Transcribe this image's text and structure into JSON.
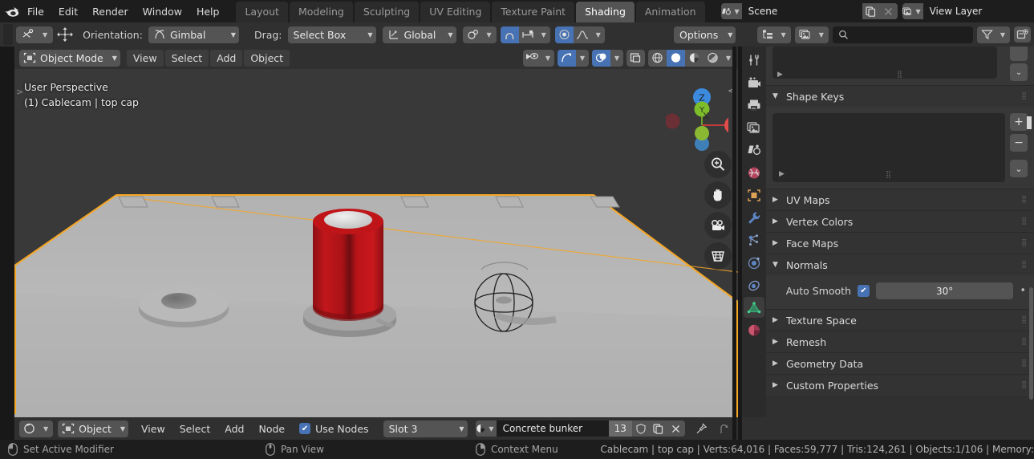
{
  "app": {
    "name": "Blender",
    "logo_icon": "blender-logo"
  },
  "topbar": {
    "menus": [
      "File",
      "Edit",
      "Render",
      "Window",
      "Help"
    ],
    "workspaces": [
      {
        "label": "Layout",
        "active": false
      },
      {
        "label": "Modeling",
        "active": false
      },
      {
        "label": "Sculpting",
        "active": false
      },
      {
        "label": "UV Editing",
        "active": false
      },
      {
        "label": "Texture Paint",
        "active": false
      },
      {
        "label": "Shading",
        "active": true
      },
      {
        "label": "Animation",
        "active": false
      }
    ],
    "scene": {
      "icon": "scene-icon",
      "value": "Scene",
      "new_icon": "duplicate-icon",
      "unlink_icon": "close-icon"
    },
    "view_layer": {
      "icon": "view-layer-icon",
      "value": "View Layer",
      "new_icon": "duplicate-icon",
      "unlink_icon": "close-icon"
    }
  },
  "tool_header": {
    "active_tool_icon": "tweak-tool-icon",
    "transform_icon": "move-gizmo-icon",
    "orientation_label": "Orientation:",
    "orientation_value": "Gimbal",
    "orientation_icon": "gimbal-icon",
    "drag_label": "Drag:",
    "drag_value": "Select Box",
    "transform_space_icon": "global-axes-icon",
    "transform_space_value": "Global",
    "snap_icon": "snap-magnet-icon",
    "snap_target_icon": "snap-increment-icon",
    "proportional_icon": "proportional-edit-icon",
    "falloff_icon": "smooth-falloff-icon",
    "options_label": "Options"
  },
  "outliner_header": {
    "display_mode_icon": "outliner-display-icon",
    "id_type_icon": "image-data-icon",
    "search_icon": "search-icon",
    "search_value": "",
    "search_placeholder": "",
    "filter_icon": "filter-funnel-icon",
    "new_collection_icon": "new-collection-icon"
  },
  "viewport_header": {
    "mode": "Object Mode",
    "mode_icon": "object-mode-icon",
    "menus": [
      "View",
      "Select",
      "Add",
      "Object"
    ],
    "visibility_icon": "show-hide-eye-icon",
    "gizmo_icon": "gizmo-arrow-icon",
    "gizmo_active": true,
    "overlays_icon": "overlays-icon",
    "overlays_active": true,
    "xray_icon": "xray-toggle-icon",
    "shading_modes": [
      {
        "icon": "wireframe-shading-icon",
        "active": false
      },
      {
        "icon": "solid-shading-icon",
        "active": true
      },
      {
        "icon": "material-preview-shading-icon",
        "active": false
      },
      {
        "icon": "rendered-shading-icon",
        "active": false
      }
    ]
  },
  "viewport": {
    "overlay_line1": "User Perspective",
    "overlay_line2": "(1) Cablecam | top cap",
    "gizmo": {
      "axes": [
        {
          "label": "Z",
          "color": "#3b8ade"
        },
        {
          "label": "Y",
          "color": "#7dbd2a"
        },
        {
          "label": "X",
          "color": "#e04c4c"
        }
      ],
      "negative_colors": [
        "#6d2f36",
        "#8ab832",
        "#3e7fb8"
      ]
    },
    "nav_buttons": [
      {
        "icon": "zoom-magnifier-icon"
      },
      {
        "icon": "pan-hand-icon"
      },
      {
        "icon": "camera-view-icon"
      },
      {
        "icon": "toggle-orthographic-icon"
      }
    ],
    "colors": {
      "background": "#393939",
      "floor": "#b2b2b2",
      "floor_dark": "#9b9b9b",
      "cylinder_red": "#b41418",
      "cylinder_top": "#d8d8d8",
      "selection_outline": "#f5a623"
    }
  },
  "shader_header": {
    "editor_icon": "shader-editor-icon",
    "shader_type": "Object",
    "shader_type_icon": "object-data-icon",
    "menus": [
      "View",
      "Select",
      "Add",
      "Node"
    ],
    "use_nodes_label": "Use Nodes",
    "use_nodes_checked": true,
    "slot": "Slot 3",
    "material_icon": "material-sphere-icon",
    "material_name": "Concrete bunker",
    "users_count": "13",
    "fake_user_icon": "shield-icon",
    "new_material_icon": "duplicate-icon",
    "unlink_icon": "close-icon",
    "pin_icon": "pin-icon",
    "parent_icon": "go-to-parent-icon"
  },
  "properties": {
    "tabs": [
      {
        "icon": "tool-icon",
        "name": "tool",
        "active": false
      },
      {
        "icon": "render-camera-icon",
        "name": "render",
        "active": false
      },
      {
        "icon": "output-printer-icon",
        "name": "output",
        "active": false
      },
      {
        "icon": "view-layer-images-icon",
        "name": "view-layer",
        "active": false
      },
      {
        "icon": "scene-cone-icon",
        "name": "scene",
        "active": false
      },
      {
        "icon": "world-globe-icon",
        "name": "world",
        "active": false
      },
      {
        "icon": "object-square-icon",
        "name": "object",
        "active": false
      },
      {
        "icon": "modifier-wrench-icon",
        "name": "modifiers",
        "active": false
      },
      {
        "icon": "particles-icon",
        "name": "particles",
        "active": false
      },
      {
        "icon": "physics-orbit-icon",
        "name": "physics",
        "active": false
      },
      {
        "icon": "object-constraints-icon",
        "name": "constraints",
        "active": false
      },
      {
        "icon": "object-data-triangle-icon",
        "name": "object-data",
        "active": true
      },
      {
        "icon": "material-sphere-icon",
        "name": "material",
        "active": false
      }
    ],
    "panels": [
      {
        "label": "Shape Keys",
        "expanded": true,
        "type": "shape-keys"
      },
      {
        "label": "UV Maps",
        "expanded": false,
        "type": "simple"
      },
      {
        "label": "Vertex Colors",
        "expanded": false,
        "type": "simple"
      },
      {
        "label": "Face Maps",
        "expanded": false,
        "type": "simple"
      },
      {
        "label": "Normals",
        "expanded": true,
        "type": "normals"
      },
      {
        "label": "Texture Space",
        "expanded": false,
        "type": "simple"
      },
      {
        "label": "Remesh",
        "expanded": false,
        "type": "simple"
      },
      {
        "label": "Geometry Data",
        "expanded": false,
        "type": "simple"
      },
      {
        "label": "Custom Properties",
        "expanded": false,
        "type": "simple"
      }
    ],
    "shape_keys": {
      "add_icon": "plus-icon",
      "remove_icon": "minus-icon",
      "specials_icon": "chevron-down-icon",
      "expand_icon": "triangle-right-icon"
    },
    "normals": {
      "auto_smooth_label": "Auto Smooth",
      "auto_smooth_checked": true,
      "angle_value": "30°",
      "animate_icon": "animate-dot-icon"
    }
  },
  "status_bar": {
    "keymaps": [
      {
        "icon": "mouse-left-icon",
        "label": "Set Active Modifier"
      },
      {
        "icon": "mouse-middle-icon",
        "label": "Pan View"
      },
      {
        "icon": "mouse-right-icon",
        "label": "Context Menu"
      }
    ],
    "scene_stats": "Cablecam | top cap | Verts:64,016 | Faces:59,777 | Tris:124,261 | Objects:1/106 | Memory:"
  }
}
